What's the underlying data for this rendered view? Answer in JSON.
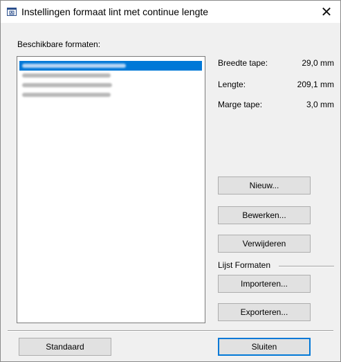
{
  "window": {
    "title": "Instellingen formaat lint met continue lengte",
    "close_glyph": "✕"
  },
  "formats": {
    "label": "Beschikbare formaten:",
    "items": [
      {
        "text": "",
        "selected": true
      },
      {
        "text": "",
        "selected": false
      },
      {
        "text": "",
        "selected": false
      },
      {
        "text": "",
        "selected": false
      }
    ]
  },
  "details": {
    "width_label": "Breedte tape:",
    "width_value": "29,0 mm",
    "length_label": "Lengte:",
    "length_value": "209,1 mm",
    "margin_label": "Marge tape:",
    "margin_value": "3,0 mm"
  },
  "buttons": {
    "new": "Nieuw...",
    "edit": "Bewerken...",
    "delete": "Verwijderen",
    "import": "Importeren...",
    "export": "Exporteren...",
    "default": "Standaard",
    "close": "Sluiten"
  },
  "list_formats_group": "Lijst Formaten",
  "colors": {
    "selection": "#0078d7",
    "button_face": "#e1e1e1",
    "dialog_bg": "#f0f0f0"
  },
  "icons": {
    "title": "tape-format-icon",
    "close": "close-icon"
  }
}
